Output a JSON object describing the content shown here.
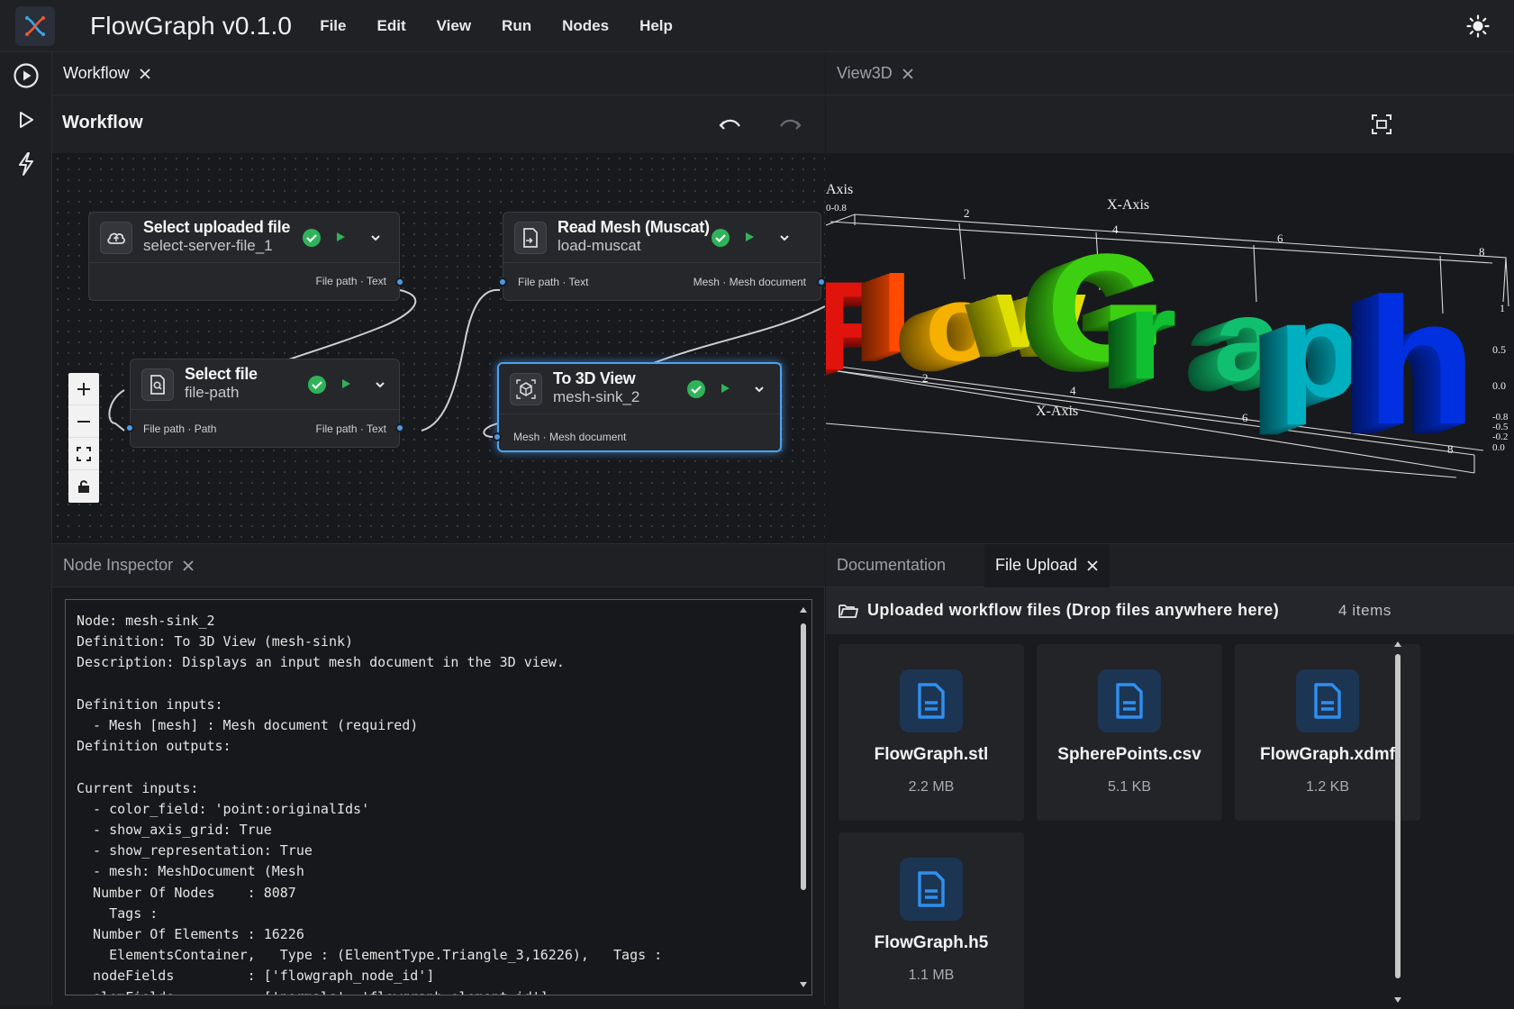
{
  "app": {
    "title": "FlowGraph v0.1.0"
  },
  "menu": [
    "File",
    "Edit",
    "View",
    "Run",
    "Nodes",
    "Help"
  ],
  "workflow_panel": {
    "tab_label": "Workflow",
    "header_title": "Workflow",
    "nodes": [
      {
        "title": "Select uploaded file",
        "subtitle": "select-server-file_1",
        "inputs": [],
        "outputs": [
          "File path · Text"
        ]
      },
      {
        "title": "Select file",
        "subtitle": "file-path",
        "inputs": [
          "File path · Path"
        ],
        "outputs": [
          "File path · Text"
        ]
      },
      {
        "title": "Read Mesh (Muscat)",
        "subtitle": "load-muscat",
        "inputs": [
          "File path · Text"
        ],
        "outputs": [
          "Mesh · Mesh document"
        ]
      },
      {
        "title": "To 3D View",
        "subtitle": "mesh-sink_2",
        "inputs": [
          "Mesh · Mesh document"
        ],
        "outputs": []
      }
    ]
  },
  "view3d_panel": {
    "tab_label": "View3D",
    "axis_labels": {
      "x_top": "X-Axis",
      "x_bottom": "X-Axis",
      "y_top": "Axis"
    },
    "top_ticks": [
      "2",
      "4",
      "6",
      "8"
    ],
    "bottom_ticks": [
      "2",
      "4",
      "6",
      "8"
    ],
    "right_ticks": [
      "1",
      "0.5",
      "0.0",
      "-0.8",
      "-0.5",
      "-0.2",
      "0.0"
    ],
    "corner_ticks": "0-0.8",
    "letters": [
      {
        "ch": "F",
        "color": "#e0140c"
      },
      {
        "ch": "l",
        "color": "#ff4a00"
      },
      {
        "ch": "o",
        "color": "#f5b000"
      },
      {
        "ch": "w",
        "color": "#e0e000"
      },
      {
        "ch": "G",
        "color": "#3cd010"
      },
      {
        "ch": "r",
        "color": "#10c030"
      },
      {
        "ch": "a",
        "color": "#10c070"
      },
      {
        "ch": "p",
        "color": "#00b0c0"
      },
      {
        "ch": "h",
        "color": "#0030e0"
      }
    ]
  },
  "inspector_panel": {
    "tab_label": "Node Inspector",
    "lines": [
      "Node: mesh-sink_2",
      "Definition: To 3D View (mesh-sink)",
      "Description: Displays an input mesh document in the 3D view.",
      "",
      "Definition inputs:",
      "  - Mesh [mesh] : Mesh document (required)",
      "Definition outputs:",
      "",
      "Current inputs:",
      "  - color_field: 'point:originalIds'",
      "  - show_axis_grid: True",
      "  - show_representation: True",
      "  - mesh: MeshDocument (Mesh",
      "  Number Of Nodes    : 8087",
      "    Tags :",
      "  Number Of Elements : 16226",
      "    ElementsContainer,   Type : (ElementType.Triangle_3,16226),   Tags :",
      "  nodeFields         : ['flowgraph_node_id']",
      "  elemFields         : ['normals', 'flowgraph_element_id']"
    ]
  },
  "docs_tab": {
    "label": "Documentation"
  },
  "file_upload_panel": {
    "tab_label": "File Upload",
    "header": "Uploaded workflow files (Drop files anywhere here)",
    "count": "4 items",
    "files": [
      {
        "name": "FlowGraph.stl",
        "size": "2.2 MB"
      },
      {
        "name": "SpherePoints.csv",
        "size": "5.1 KB"
      },
      {
        "name": "FlowGraph.xdmf",
        "size": "1.2 KB"
      },
      {
        "name": "FlowGraph.h5",
        "size": "1.1 MB"
      }
    ]
  },
  "colors": {
    "accent": "#4aa3f0",
    "success": "#2fb35a",
    "run": "#2fb35a",
    "file_icon": "#2f8ff0"
  }
}
